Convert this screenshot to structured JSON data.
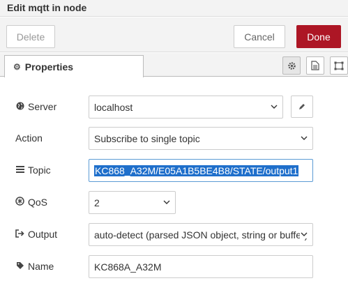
{
  "dialog": {
    "title": "Edit mqtt in node"
  },
  "toolbar": {
    "delete_label": "Delete",
    "cancel_label": "Cancel",
    "done_label": "Done"
  },
  "tabs": {
    "properties_label": "Properties"
  },
  "form": {
    "server": {
      "label": "Server",
      "value": "localhost",
      "icon": "globe-icon"
    },
    "action": {
      "label": "Action",
      "value": "Subscribe to single topic"
    },
    "topic": {
      "label": "Topic",
      "value": "KC868_A32M/E05A1B5BE4B8/STATE/output1",
      "icon": "list-icon"
    },
    "qos": {
      "label": "QoS",
      "value": "2",
      "icon": "qos-icon"
    },
    "output": {
      "label": "Output",
      "value": "auto-detect (parsed JSON object, string or buffer)",
      "icon": "sign-out-icon"
    },
    "name": {
      "label": "Name",
      "value": "KC868A_A32M",
      "icon": "tag-icon"
    }
  },
  "colors": {
    "done_button": "#ad1625",
    "selection": "#1f6fcb"
  }
}
